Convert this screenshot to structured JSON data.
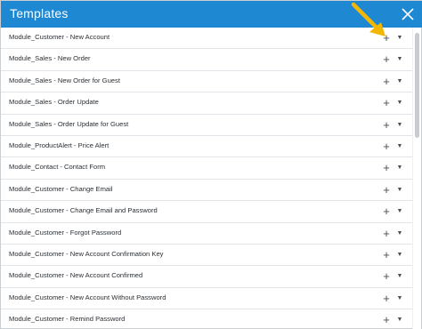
{
  "dialog": {
    "title": "Templates"
  },
  "icons": {
    "close": "close-icon",
    "add": "plus-icon",
    "more": "caret-down-icon",
    "pointer": "arrow-icon"
  },
  "colors": {
    "header": "#1e88d3",
    "arrow": "#f2b705"
  },
  "templates": [
    {
      "label": "Module_Customer - New Account",
      "add": "+",
      "more": "▼"
    },
    {
      "label": "Module_Sales - New Order",
      "add": "+",
      "more": "▼"
    },
    {
      "label": "Module_Sales - New Order for Guest",
      "add": "+",
      "more": "▼"
    },
    {
      "label": "Module_Sales - Order Update",
      "add": "+",
      "more": "▼"
    },
    {
      "label": "Module_Sales - Order Update for Guest",
      "add": "+",
      "more": "▼"
    },
    {
      "label": "Module_ProductAlert - Price Alert",
      "add": "+",
      "more": "▼"
    },
    {
      "label": "Module_Contact - Contact Form",
      "add": "+",
      "more": "▼"
    },
    {
      "label": "Module_Customer - Change Email",
      "add": "+",
      "more": "▼"
    },
    {
      "label": "Module_Customer - Change Email and Password",
      "add": "+",
      "more": "▼"
    },
    {
      "label": "Module_Customer - Forgot Password",
      "add": "+",
      "more": "▼"
    },
    {
      "label": "Module_Customer - New Account Confirmation Key",
      "add": "+",
      "more": "▼"
    },
    {
      "label": "Module_Customer - New Account Confirmed",
      "add": "+",
      "more": "▼"
    },
    {
      "label": "Module_Customer - New Account Without Password",
      "add": "+",
      "more": "▼"
    },
    {
      "label": "Module_Customer - Remind Password",
      "add": "+",
      "more": "▼"
    }
  ]
}
